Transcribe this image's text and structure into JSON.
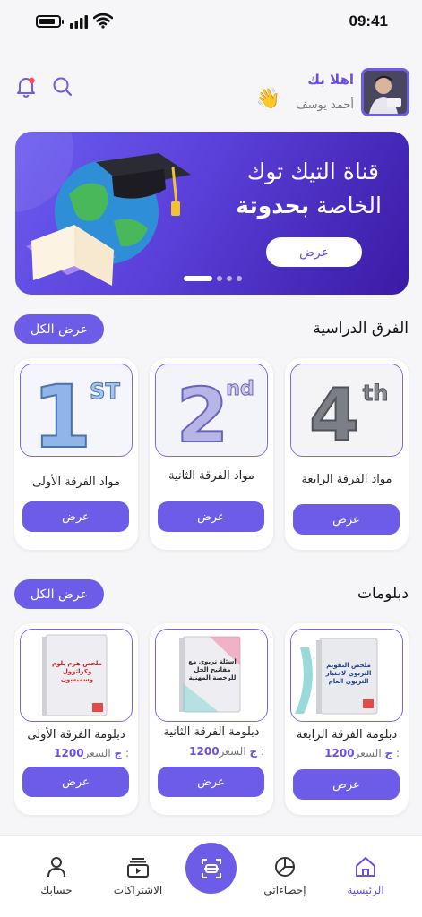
{
  "status_bar": {
    "time": "09:41"
  },
  "header": {
    "greeting": "اهلا بك",
    "username": "أحمد يوسف",
    "wave_emoji": "👋",
    "icons": [
      "bell-icon",
      "search-icon"
    ]
  },
  "banner": {
    "line1": "قناة التيك توك",
    "line2_regular": "الخاصة ",
    "line2_bold": "بحدوتة",
    "button_label": "عرض",
    "slides_count": 4,
    "active_slide": 0
  },
  "grades": {
    "title": "الفرق الدراسية",
    "view_all": "عرض الكل",
    "items": [
      {
        "title": "مواد الفرقة الرابعة",
        "badge": "4",
        "badge_sup": "th",
        "button": "عرض"
      },
      {
        "title": "مواد الفرقة الثانية",
        "badge": "2",
        "badge_sup": "nd",
        "button": "عرض"
      },
      {
        "title": "مواد الفرقة الأولى",
        "badge": "1",
        "badge_sup": "ST",
        "button": "عرض"
      }
    ]
  },
  "diplomas": {
    "title": "دبلومات",
    "view_all": "عرض الكل",
    "price_label": "السعر :",
    "items": [
      {
        "title": "دبلومة الفرقة الرابعة",
        "price": "1200ج",
        "book_text": "ملخص التقويم التربوي لاختبار التربوي العام",
        "button": "عرض"
      },
      {
        "title": "دبلومة الفرقة الثانية",
        "price": "1200ج",
        "book_text": "اسئلة تربوي مع مفاتيح الحل للرخصة المهنية",
        "button": "عرض"
      },
      {
        "title": "دبلومة الفرقة الأولى",
        "price": "1200ج",
        "book_text": "ملخص هرم بلوم وكراثوول وسمبسون",
        "button": "عرض"
      }
    ]
  },
  "bottom_nav": {
    "items": [
      {
        "label": "الرئيسية",
        "icon": "home-icon",
        "active": true
      },
      {
        "label": "إحصاءاتي",
        "icon": "pie-chart-icon",
        "active": false
      },
      {
        "label": "الاشتراكات",
        "icon": "subscriptions-icon",
        "active": false
      },
      {
        "label": "حسابك",
        "icon": "user-icon",
        "active": false
      }
    ],
    "center_icon": "scan-icon"
  },
  "colors": {
    "accent": "#6c5ce7",
    "accent_text": "#6c4fe0",
    "background": "#f6f6f8"
  }
}
